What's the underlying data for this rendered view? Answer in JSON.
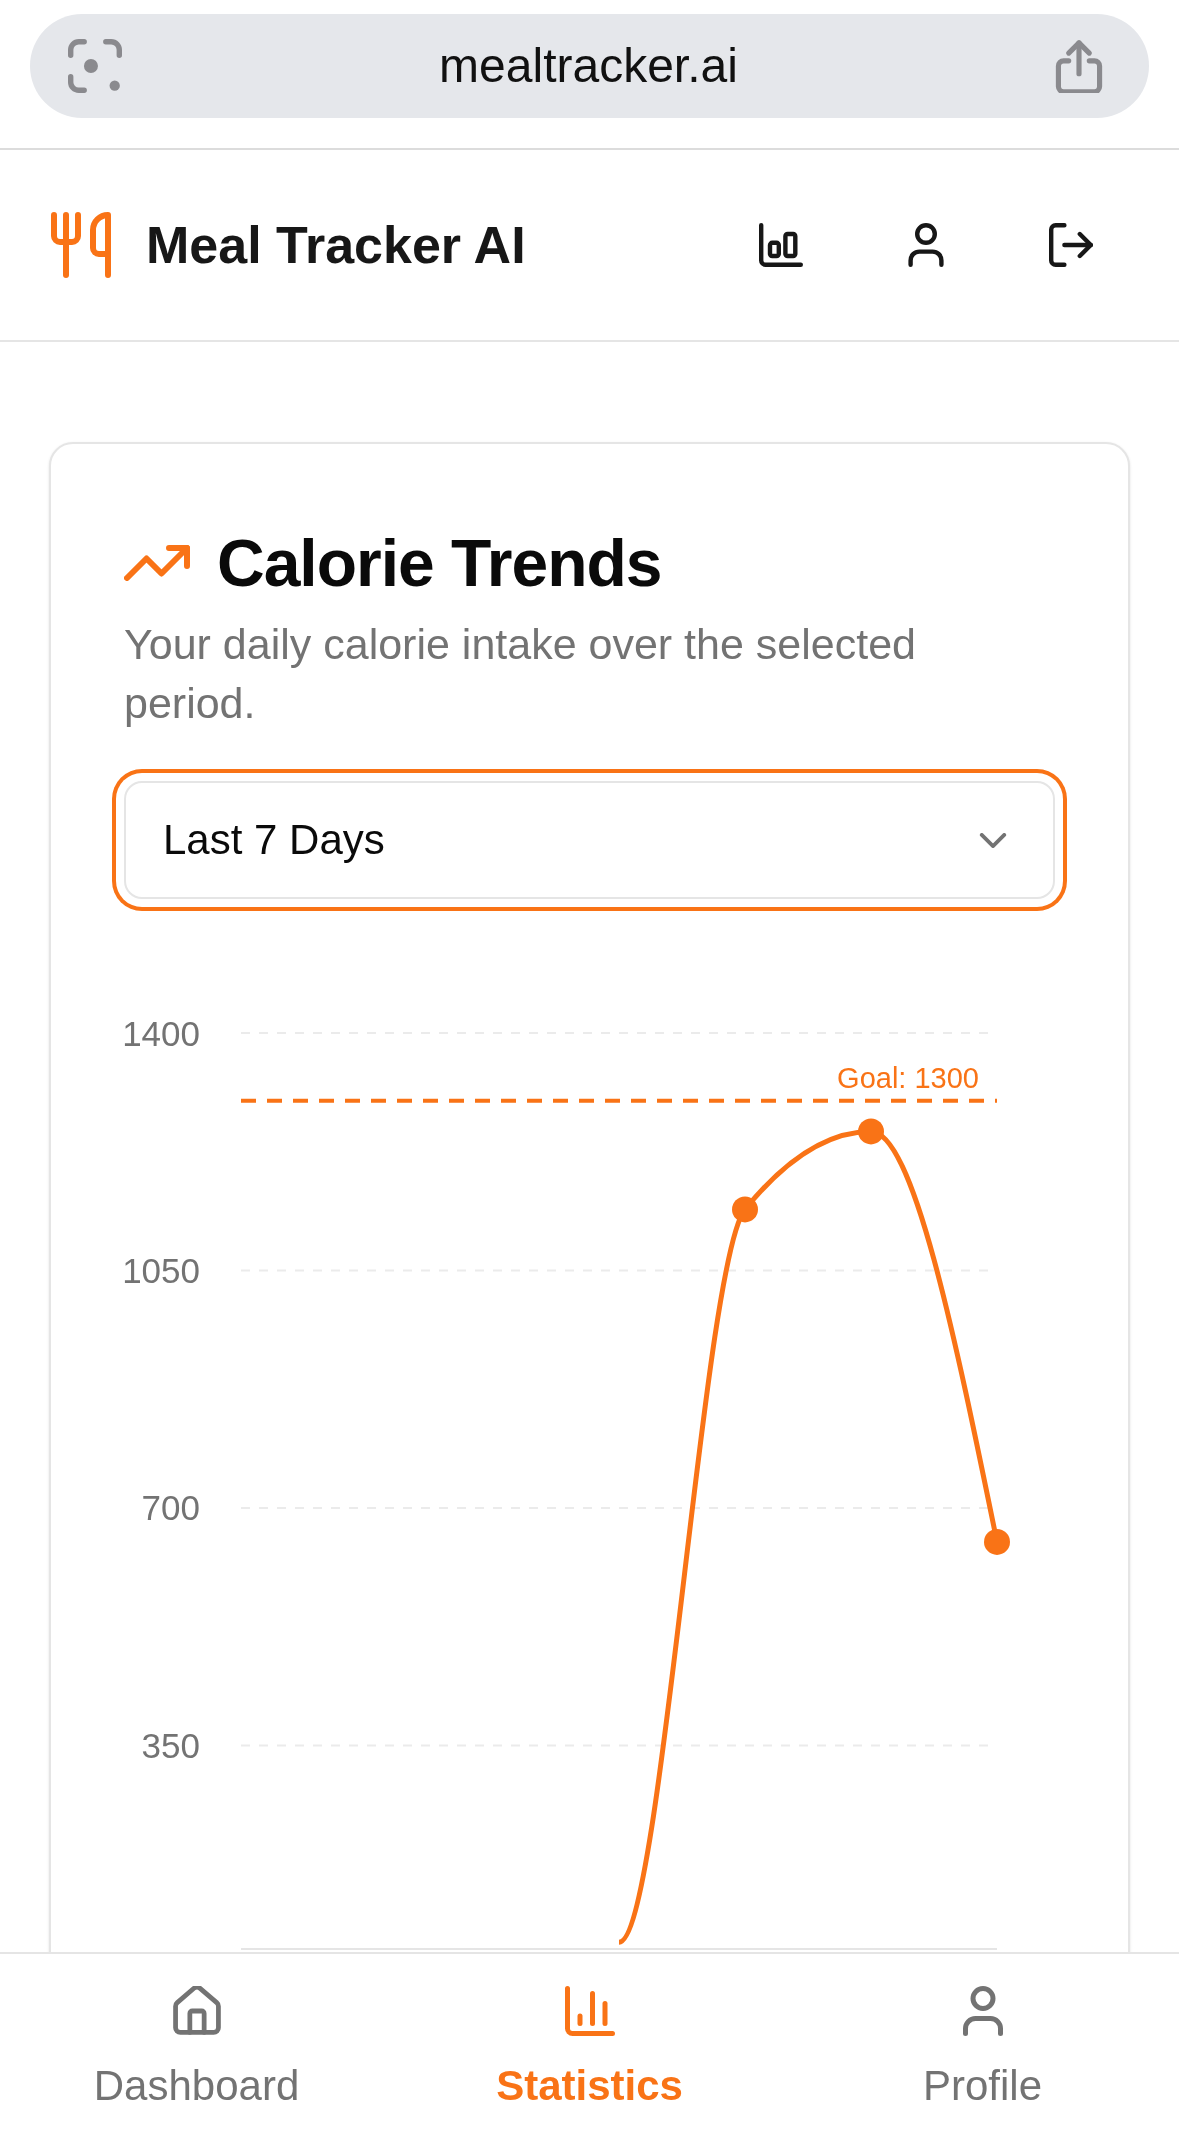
{
  "browser_bar": {
    "url": "mealtracker.ai"
  },
  "header": {
    "title": "Meal Tracker AI"
  },
  "card": {
    "title": "Calorie Trends",
    "subtitle": "Your daily calorie intake over the selected period.",
    "period_select": {
      "value": "Last 7 Days",
      "focused": true
    },
    "chart_data": {
      "type": "line",
      "values": [
        null,
        null,
        null,
        60,
        1140,
        1255,
        650
      ],
      "ylim": [
        50,
        1400
      ],
      "yticks": [
        350,
        700,
        1050,
        1400
      ],
      "grid": true,
      "ref_lines": [
        {
          "axis": "y",
          "value": 1300,
          "label": "Goal: 1300"
        }
      ]
    }
  },
  "bottom_nav": [
    {
      "label": "Dashboard",
      "selected": false
    },
    {
      "label": "Statistics",
      "selected": true
    },
    {
      "label": "Profile",
      "selected": false
    }
  ]
}
